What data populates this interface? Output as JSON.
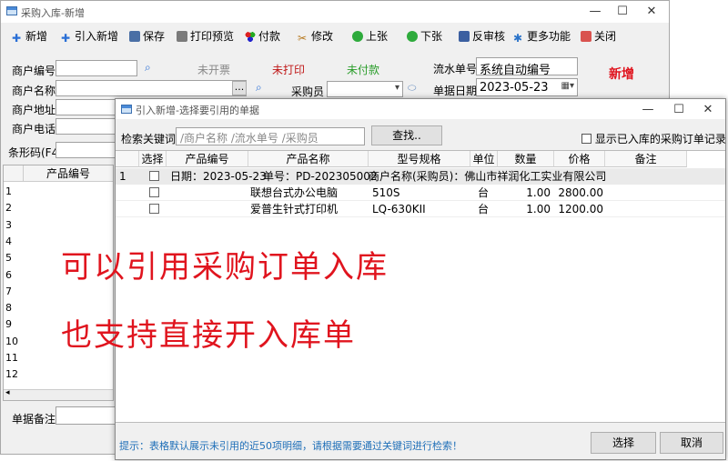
{
  "main": {
    "title": "采购入库-新增",
    "toolbar": [
      "新增",
      "引入新增",
      "保存",
      "打印预览",
      "付款",
      "修改",
      "上张",
      "下张",
      "反审核",
      "更多功能",
      "关闭"
    ],
    "fields": {
      "merchant_no": "商户编号",
      "merchant_name": "商户名称",
      "merchant_addr": "商户地址",
      "merchant_phone": "商户电话",
      "buyer": "采购员",
      "serial_label": "流水单号",
      "serial_value": "系统自动编号",
      "date_label": "单据日期",
      "date_value": "2023-05-23",
      "barcode": "条形码(F4)",
      "remark": "单据备注",
      "more_btn": "..."
    },
    "status": {
      "invoice": "未开票",
      "print": "未打印",
      "pay": "未付款",
      "mode": "新增"
    },
    "grid": {
      "col": "产品编号",
      "rows": [
        "1",
        "2",
        "3",
        "4",
        "5",
        "6",
        "7",
        "8",
        "9",
        "10",
        "11",
        "12"
      ]
    }
  },
  "dialog": {
    "title": "引入新增-选择要引用的单据",
    "search_label": "检索关键词",
    "search_placeholder": "/商户名称 /流水单号 /采购员",
    "search_btn": "查找..",
    "show_all": "显示已入库的采购订单记录",
    "columns": [
      "选择",
      "产品编号",
      "产品名称",
      "型号规格",
      "单位",
      "数量",
      "价格",
      "备注"
    ],
    "group": {
      "row_no": "1",
      "date": "日期：2023-05-23",
      "order": "单号：PD-202305002",
      "merchant": "商户名称(采购员)：佛山市祥润化工实业有限公司"
    },
    "items": [
      {
        "name": "联想台式办公电脑",
        "model": "510S",
        "unit": "台",
        "qty": "1.00",
        "price": "2800.00"
      },
      {
        "name": "爱普生针式打印机",
        "model": "LQ-630KII",
        "unit": "台",
        "qty": "1.00",
        "price": "1200.00"
      }
    ],
    "hint": "提示：表格默认展示未引用的近50项明细，请根据需要通过关键词进行检索！",
    "ok_btn": "选择",
    "cancel_btn": "取消"
  },
  "overlay": {
    "line1": "可以引用采购订单入库",
    "line2": "也支持直接开入库单"
  },
  "colors": {
    "accent_red": "#e0141e",
    "status_green": "#2a9d2a",
    "hint_blue": "#1f6fb8"
  }
}
